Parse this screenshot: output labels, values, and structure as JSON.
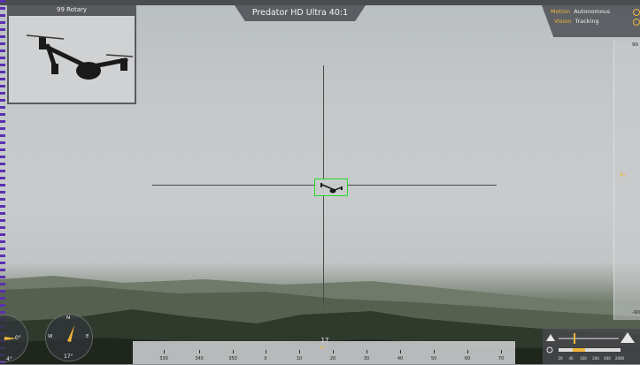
{
  "camera": {
    "title": "Predator HD Ultra 40:1"
  },
  "inset": {
    "label": "99 Rotary"
  },
  "status": [
    {
      "key": "Motion",
      "value": "Autonomous"
    },
    {
      "key": "Vision",
      "value": "Tracking"
    }
  ],
  "elevation": {
    "top": "90",
    "bottom": "-90",
    "marker": "4"
  },
  "compass_left": {
    "value": "0°",
    "bottom_value": "4°"
  },
  "compass_right": {
    "north": "N",
    "east": "E",
    "west": "W",
    "value": "17°"
  },
  "heading": {
    "current": "17",
    "ticks": [
      "330",
      "340",
      "350",
      "0",
      "10",
      "20",
      "30",
      "40",
      "50",
      "60",
      "70"
    ]
  },
  "zoom": {
    "labels": [
      "20",
      "40",
      "100",
      "200",
      "400",
      "2000"
    ]
  },
  "colors": {
    "accent": "#f2b63a",
    "target": "#27d827",
    "panel": "#505256"
  }
}
